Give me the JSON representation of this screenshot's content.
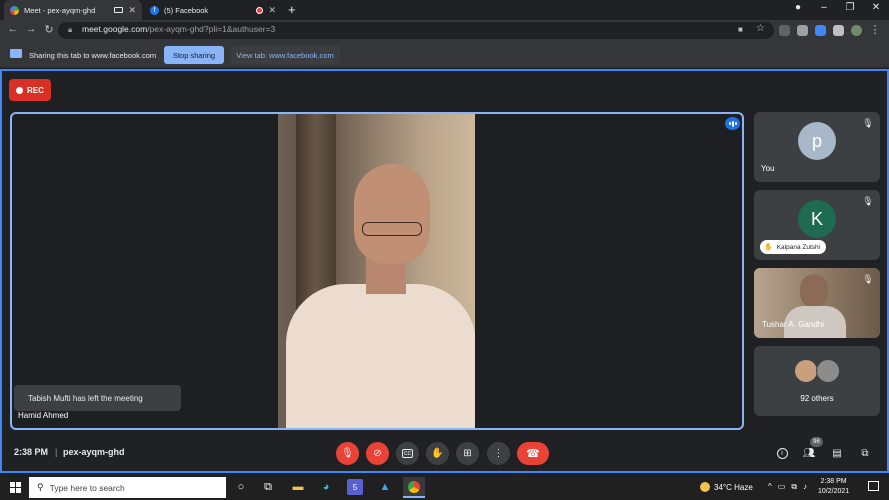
{
  "browser": {
    "tabs": [
      {
        "title": "Meet - pex-ayqm-ghd",
        "active": true
      },
      {
        "title": "(5) Facebook",
        "active": false
      }
    ],
    "new_tab_label": "+",
    "url_host": "meet.google.com",
    "url_path": "/pex-ayqm-ghd?pli=1&authuser=3"
  },
  "share_bar": {
    "message": "Sharing this tab to www.facebook.com",
    "stop_label": "Stop sharing",
    "view_label": "View tab: www.facebook.com"
  },
  "meet": {
    "rec_label": "REC",
    "main_participant": "Hamid Ahmed",
    "toast": "Tabish Mufti has left the meeting",
    "participants": [
      {
        "name": "You",
        "initial": "p",
        "color": "#a8b8c8",
        "muted": true
      },
      {
        "name": "Kalpana Zutshi",
        "initial": "K",
        "color": "#1e6b52",
        "muted": true
      },
      {
        "name": "Tushar A. Gandhi",
        "initial": "",
        "color": "",
        "muted": true
      },
      {
        "name": "92 others",
        "initial": "",
        "color": "",
        "muted": false
      }
    ],
    "time": "2:38 PM",
    "separator": "|",
    "meeting_code": "pex-ayqm-ghd",
    "people_count": "96"
  },
  "taskbar": {
    "search_placeholder": "Type here to search",
    "weather": "34°C  Haze",
    "time": "2:38 PM",
    "date": "10/2/2021",
    "meet_badge": "5"
  },
  "colors": {
    "accent_blue": "#8ab4f8",
    "danger_red": "#ea4335",
    "tile_bg": "#3c4043"
  }
}
